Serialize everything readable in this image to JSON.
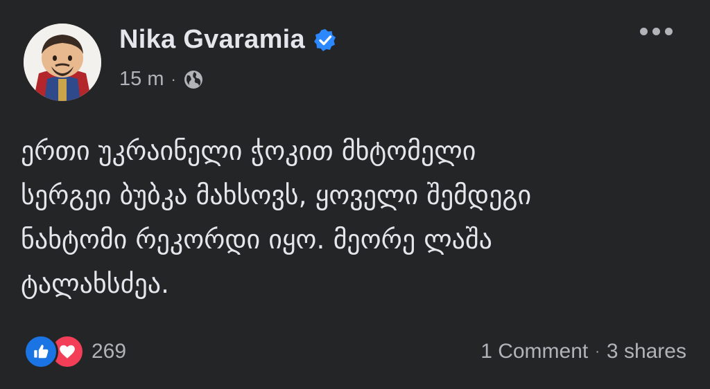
{
  "post": {
    "author": "Nika Gvaramia",
    "time": "15 m",
    "separator": "·",
    "text": "ერთი უკრაინელი ჭოკით მხტომელი\nსერგეი ბუბკა მახსოვს, ყოველი შემდეგი\nნახტომი რეკორდი იყო. მეორე ლაშა\nტალახსძეა."
  },
  "footer": {
    "reaction_count": "269",
    "comments": "1 Comment",
    "separator": "·",
    "shares": "3 shares"
  },
  "colors": {
    "background": "#242526",
    "text": "#e4e6eb",
    "secondary": "#b0b3b8",
    "verified": "#2d88ff",
    "like": "#1b74e4",
    "love": "#f33e58"
  },
  "icons": [
    "verified-badge-icon",
    "globe-icon",
    "more-options-icon",
    "like-reaction-icon",
    "love-reaction-icon"
  ]
}
